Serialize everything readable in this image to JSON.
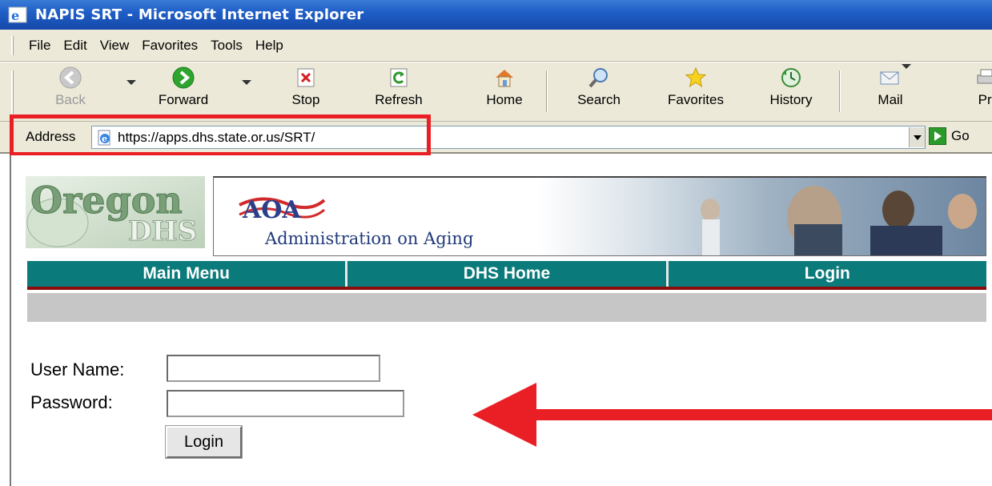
{
  "window": {
    "title": "NAPIS SRT - Microsoft Internet Explorer"
  },
  "menu": {
    "items": [
      "File",
      "Edit",
      "View",
      "Favorites",
      "Tools",
      "Help"
    ]
  },
  "toolbar": {
    "buttons": [
      {
        "label": "Back",
        "icon": "back-arrow-icon",
        "enabled": false
      },
      {
        "label": "Forward",
        "icon": "forward-arrow-icon",
        "enabled": true
      },
      {
        "label": "Stop",
        "icon": "stop-icon",
        "enabled": true
      },
      {
        "label": "Refresh",
        "icon": "refresh-icon",
        "enabled": true
      },
      {
        "label": "Home",
        "icon": "home-icon",
        "enabled": true
      },
      {
        "label": "Search",
        "icon": "search-icon",
        "enabled": true
      },
      {
        "label": "Favorites",
        "icon": "star-icon",
        "enabled": true
      },
      {
        "label": "History",
        "icon": "history-icon",
        "enabled": true
      },
      {
        "label": "Mail",
        "icon": "mail-icon",
        "enabled": true
      },
      {
        "label": "Pri",
        "icon": "print-icon",
        "enabled": true
      }
    ]
  },
  "address": {
    "label": "Address",
    "url": "https://apps.dhs.state.or.us/SRT/",
    "go_label": "Go"
  },
  "header": {
    "logo_text_top": "Oregon",
    "logo_text_bottom": "DHS",
    "aoa_logo": "AOA",
    "agency": "Administration on Aging"
  },
  "nav": {
    "items": [
      "Main Menu",
      "DHS Home",
      "Login"
    ]
  },
  "login": {
    "username_label": "User Name:",
    "password_label": "Password:",
    "username_value": "",
    "password_value": "",
    "submit_label": "Login"
  },
  "colors": {
    "title_bar": "#1f5fc8",
    "chrome": "#ece9d8",
    "nav_bar": "#0b7a7a",
    "nav_underline": "#8a0c0c",
    "annotation_red": "#ea1f25"
  }
}
